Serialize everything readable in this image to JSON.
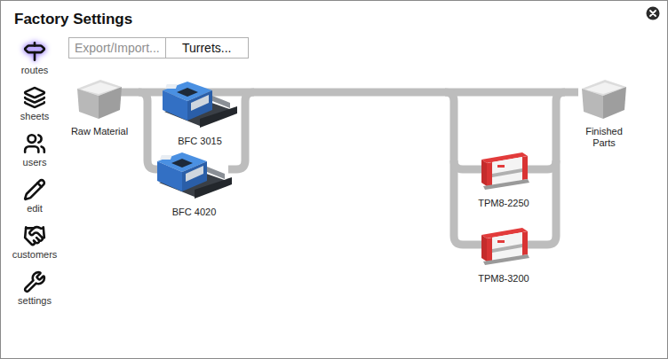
{
  "window": {
    "title": "Factory Settings"
  },
  "sidebar": {
    "items": [
      {
        "label": "routes",
        "selected": true
      },
      {
        "label": "sheets",
        "selected": false
      },
      {
        "label": "users",
        "selected": false
      },
      {
        "label": "edit",
        "selected": false
      },
      {
        "label": "customers",
        "selected": false
      },
      {
        "label": "settings",
        "selected": false
      }
    ]
  },
  "toolbar": {
    "buttons": [
      {
        "label": "Export/Import...",
        "disabled": true
      },
      {
        "label": "Turrets...",
        "disabled": false
      }
    ]
  },
  "diagram": {
    "nodes": [
      {
        "label": "Raw Material",
        "kind": "bin"
      },
      {
        "label": "BFC 3015",
        "kind": "laser"
      },
      {
        "label": "BFC 4020",
        "kind": "laser"
      },
      {
        "label": "TPM8-2250",
        "kind": "press"
      },
      {
        "label": "TPM8-3200",
        "kind": "press"
      },
      {
        "label": "Finished Parts",
        "kind": "bin"
      }
    ]
  }
}
